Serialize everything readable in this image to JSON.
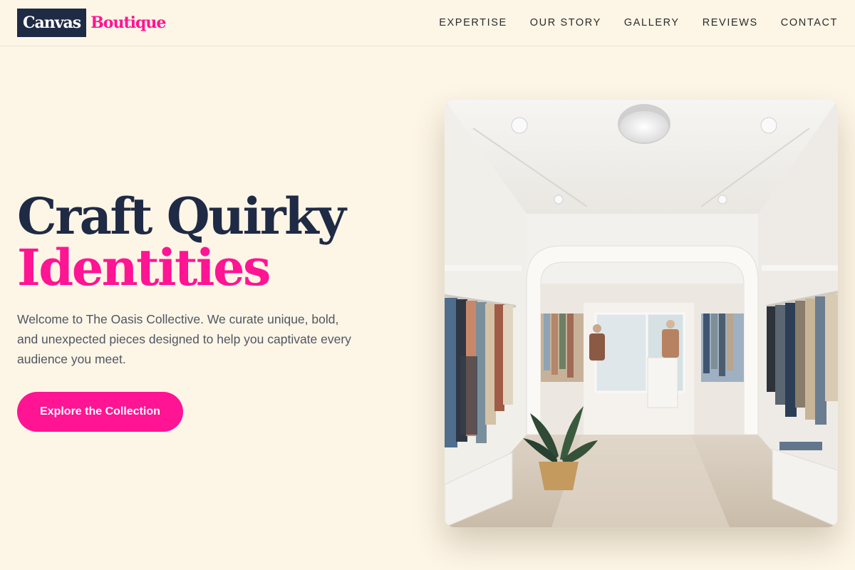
{
  "brand": {
    "name": "Canvas",
    "accent": "Boutique",
    "colors": {
      "navy": "#1f2a44",
      "pink": "#ff1493",
      "cream": "#fdf5e6"
    }
  },
  "nav": {
    "items": [
      {
        "label": "EXPERTISE"
      },
      {
        "label": "OUR STORY"
      },
      {
        "label": "GALLERY"
      },
      {
        "label": "REVIEWS"
      },
      {
        "label": "CONTACT"
      }
    ]
  },
  "hero": {
    "title_line1": "Craft Quirky",
    "title_line2": "Identities",
    "description": "Welcome to The Oasis Collective. We curate unique, bold, and unexpected pieces designed to help you captivate every audience you meet.",
    "cta_label": "Explore the Collection",
    "image": {
      "subject": "boutique-interior-photo"
    }
  }
}
